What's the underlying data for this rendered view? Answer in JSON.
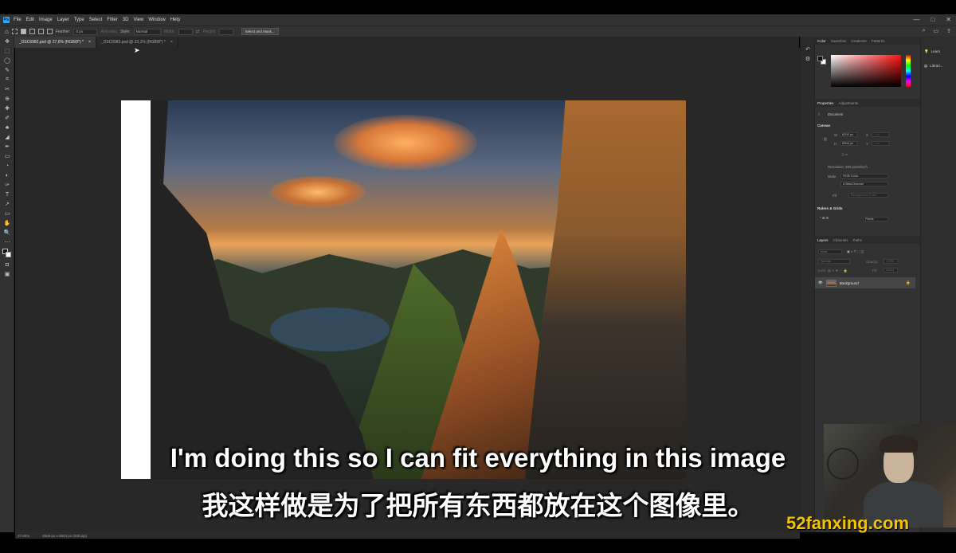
{
  "app": {
    "logo": "Ps",
    "menu": [
      "File",
      "Edit",
      "Image",
      "Layer",
      "Type",
      "Select",
      "Filter",
      "3D",
      "View",
      "Window",
      "Help"
    ],
    "window_controls": [
      "—",
      "□",
      "✕"
    ]
  },
  "options_bar": {
    "feather_label": "Feather:",
    "feather_value": "0 px",
    "antialias_label": "Anti-alias",
    "style_label": "Style:",
    "style_value": "Normal",
    "width_label": "Width:",
    "height_label": "Height:",
    "select_mask_label": "Select and Mask..."
  },
  "tabs": [
    {
      "label": "_DSC6982.psd @ 27,6% (RGB/8*) *",
      "active": true
    },
    {
      "label": "_DSC6983.psd @ 23,1% (RGB/8*) *",
      "active": false
    }
  ],
  "tools": [
    "✥",
    "⬚",
    "◯",
    "✎",
    "⌗",
    "✂",
    "⊕",
    "✚",
    "✐",
    "♣",
    "◢",
    "✒",
    "▭",
    "◔",
    "◐",
    "✑",
    "T",
    "➚",
    "▭",
    "✋",
    "🔍",
    "⋯"
  ],
  "subtitles": {
    "english": "I'm doing this so I can fit everything in this image",
    "chinese": "我这样做是为了把所有东西都放在这个图像里。"
  },
  "status_bar": {
    "zoom": "27,65%",
    "doc_info": "8200 px x 5504 px (300 ppi)"
  },
  "color_panel": {
    "tabs": [
      "Color",
      "Swatches",
      "Gradients",
      "Patterns"
    ],
    "foreground": "#111111",
    "background": "#ffffff"
  },
  "properties_panel": {
    "tabs": [
      "Properties",
      "Adjustments"
    ],
    "doc_label": "Document",
    "canvas_title": "Canvas",
    "w_label": "W",
    "w_value": "8200 px",
    "h_label": "H",
    "h_value": "5504 px",
    "x_label": "X",
    "x_value": "0 px",
    "y_label": "Y",
    "y_value": "0 px",
    "resolution": "Resolution: 300 pixels/inch",
    "mode_label": "Mode",
    "mode_value": "RGB Color",
    "depth_value": "8 Bits/Channel",
    "fill_label": "Fill",
    "fill_value": "Background Color",
    "rulers_title": "Rulers & Grids",
    "rulers_unit": "Pixels"
  },
  "layers_panel": {
    "tabs": [
      "Layers",
      "Channels",
      "Paths"
    ],
    "kind_label": "Kind",
    "blend_mode": "Normal",
    "opacity_label": "Opacity:",
    "opacity_value": "100%",
    "lock_label": "Lock:",
    "fill_label": "Fill:",
    "fill_value": "100%",
    "layer_name": "Background"
  },
  "learn_panel": {
    "items": [
      "Learn",
      "Librari..."
    ]
  },
  "watermark": "52fanxing.com"
}
